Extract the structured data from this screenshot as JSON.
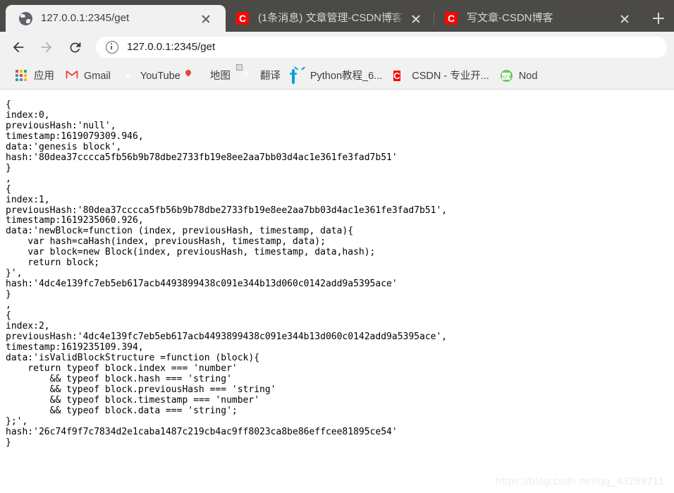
{
  "browser": {
    "tabs": [
      {
        "title": "127.0.0.1:2345/get",
        "favicon": "globe-icon",
        "active": true,
        "close_label": "×"
      },
      {
        "title": "(1条消息) 文章管理-CSDN博客",
        "favicon": "csdn-icon",
        "active": false,
        "close_label": "×"
      },
      {
        "title": "写文章-CSDN博客",
        "favicon": "csdn-icon",
        "active": false,
        "close_label": "×"
      }
    ],
    "new_tab_label": "+",
    "toolbar": {
      "back_icon": "arrow-left-icon",
      "forward_icon": "arrow-right-icon",
      "reload_icon": "reload-icon",
      "site_info_icon": "info-circle-icon",
      "url": "127.0.0.1:2345/get"
    },
    "bookmarks": [
      {
        "label": "应用",
        "icon": "apps-grid-icon"
      },
      {
        "label": "Gmail",
        "icon": "gmail-icon"
      },
      {
        "label": "YouTube",
        "icon": "youtube-icon"
      },
      {
        "label": "地图",
        "icon": "google-maps-icon"
      },
      {
        "label": "翻译",
        "icon": "google-translate-icon"
      },
      {
        "label": "Python教程_6...",
        "icon": "bilibili-icon"
      },
      {
        "label": "CSDN - 专业开...",
        "icon": "csdn-icon"
      },
      {
        "label": "Nod",
        "icon": "nodejs-icon"
      }
    ]
  },
  "page": {
    "content_type": "json-blockchain-dump",
    "body_text": "{\nindex:0,\npreviousHash:'null',\ntimestamp:1619079309.946,\ndata:'genesis block',\nhash:'80dea37cccca5fb56b9b78dbe2733fb19e8ee2aa7bb03d4ac1e361fe3fad7b51'\n}\n,\n{\nindex:1,\npreviousHash:'80dea37cccca5fb56b9b78dbe2733fb19e8ee2aa7bb03d4ac1e361fe3fad7b51',\ntimestamp:1619235060.926,\ndata:'newBlock=function (index, previousHash, timestamp, data){\n    var hash=caHash(index, previousHash, timestamp, data);\n    var block=new Block(index, previousHash, timestamp, data,hash);\n    return block;\n}',\nhash:'4dc4e139fc7eb5eb617acb4493899438c091e344b13d060c0142add9a5395ace'\n}\n,\n{\nindex:2,\npreviousHash:'4dc4e139fc7eb5eb617acb4493899438c091e344b13d060c0142add9a5395ace',\ntimestamp:1619235109.394,\ndata:'isValidBlockStructure =function (block){\n    return typeof block.index === 'number'\n        && typeof block.hash === 'string'\n        && typeof block.previousHash === 'string'\n        && typeof block.timestamp === 'number'\n        && typeof block.data === 'string';\n};',\nhash:'26c74f9f7c7834d2e1caba1487c219cb4ac9ff8023ca8be86effcee81895ce54'\n}",
    "blocks": [
      {
        "index": 0,
        "previousHash": "null",
        "timestamp": "1619079309.946",
        "data": "genesis block",
        "hash": "80dea37cccca5fb56b9b78dbe2733fb19e8ee2aa7bb03d4ac1e361fe3fad7b51"
      },
      {
        "index": 1,
        "previousHash": "80dea37cccca5fb56b9b78dbe2733fb19e8ee2aa7bb03d4ac1e361fe3fad7b51",
        "timestamp": "1619235060.926",
        "data": "newBlock=function (index, previousHash, timestamp, data){\n    var hash=caHash(index, previousHash, timestamp, data);\n    var block=new Block(index, previousHash, timestamp, data,hash);\n    return block;\n}",
        "hash": "4dc4e139fc7eb5eb617acb4493899438c091e344b13d060c0142add9a5395ace"
      },
      {
        "index": 2,
        "previousHash": "4dc4e139fc7eb5eb617acb4493899438c091e344b13d060c0142add9a5395ace",
        "timestamp": "1619235109.394",
        "data": "isValidBlockStructure =function (block){\n    return typeof block.index === 'number'\n        && typeof block.hash === 'string'\n        && typeof block.previousHash === 'string'\n        && typeof block.timestamp === 'number'\n        && typeof block.data === 'string';\n};",
        "hash": "26c74f9f7c7834d2e1caba1487c219cb4ac9ff8023ca8be86effcee81895ce54"
      }
    ],
    "watermark": "https://blog.csdn.net/qq_43289711"
  },
  "colors": {
    "tabstrip_bg": "#4b4a46",
    "toolbar_bg": "#f1f1f1",
    "active_tab_bg": "#f1f1f1",
    "csdn_red": "#fc0404",
    "text": "#3c4043",
    "page_text": "#000000",
    "watermark": "#ededed"
  }
}
